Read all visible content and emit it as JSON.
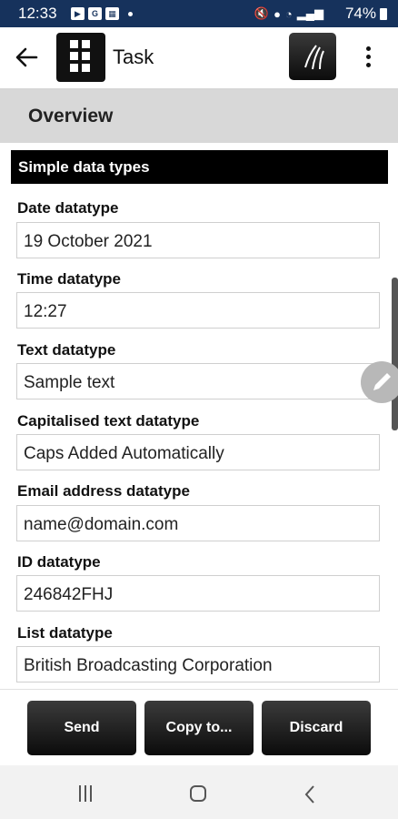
{
  "status_bar": {
    "time": "12:33",
    "battery": "74%"
  },
  "app_bar": {
    "title": "Task"
  },
  "overview": {
    "label": "Overview"
  },
  "section": {
    "title": "Simple data types"
  },
  "fields": [
    {
      "label": "Date datatype",
      "value": "19 October 2021"
    },
    {
      "label": "Time datatype",
      "value": "12:27"
    },
    {
      "label": "Text datatype",
      "value": "Sample text"
    },
    {
      "label": "Capitalised text datatype",
      "value": "Caps Added Automatically"
    },
    {
      "label": "Email address datatype",
      "value": "name@domain.com"
    },
    {
      "label": "ID datatype",
      "value": "246842FHJ"
    },
    {
      "label": "List datatype",
      "value": "British Broadcasting Corporation"
    }
  ],
  "actions": {
    "send": "Send",
    "copy": "Copy to...",
    "discard": "Discard"
  },
  "icons": {
    "back": "arrow-left-icon",
    "logo": "grid-logo-icon",
    "sync": "sync-road-icon",
    "menu": "more-vert-icon",
    "edit": "pencil-icon"
  },
  "colors": {
    "status_bar": "#16325c",
    "section_header": "#000000",
    "overview_bg": "#d8d8d8"
  }
}
